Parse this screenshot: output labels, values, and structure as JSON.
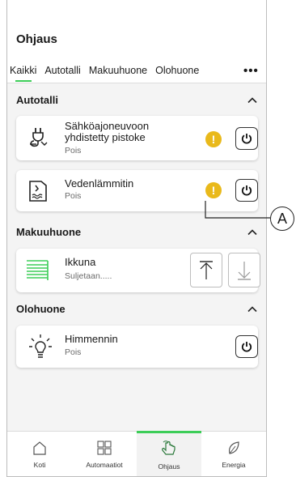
{
  "header": {
    "title": "Ohjaus"
  },
  "tabs": [
    {
      "label": "Kaikki",
      "active": true
    },
    {
      "label": "Autotalli"
    },
    {
      "label": "Makuuhuone"
    },
    {
      "label": "Olohuone"
    }
  ],
  "tabs_more": "•••",
  "sections": [
    {
      "title": "Autotalli",
      "devices": [
        {
          "name_line1": "Sähköajoneuvoon",
          "name_line2": "yhdistetty pistoke",
          "status": "Pois",
          "icon": "ev-plug-icon",
          "warning": "!"
        },
        {
          "name": "Vedenlämmitin",
          "status": "Pois",
          "icon": "water-heater-icon",
          "warning": "!"
        }
      ]
    },
    {
      "title": "Makuuhuone",
      "devices": [
        {
          "name": "Ikkuna",
          "status": "Suljetaan.....",
          "icon": "window-blind-icon"
        }
      ]
    },
    {
      "title": "Olohuone",
      "devices": [
        {
          "name": "Himmennin",
          "status": "Pois",
          "icon": "dimmer-bulb-icon"
        }
      ]
    }
  ],
  "bottom_nav": [
    {
      "label": "Koti",
      "icon": "home-icon"
    },
    {
      "label": "Automaatiot",
      "icon": "automations-icon"
    },
    {
      "label": "Ohjaus",
      "icon": "hand-control-icon",
      "active": true
    },
    {
      "label": "Energia",
      "icon": "leaf-icon"
    }
  ],
  "callout_label": "A",
  "colors": {
    "accent": "#3dcd58",
    "warning": "#e9b91b",
    "background": "#f4f4f4"
  }
}
